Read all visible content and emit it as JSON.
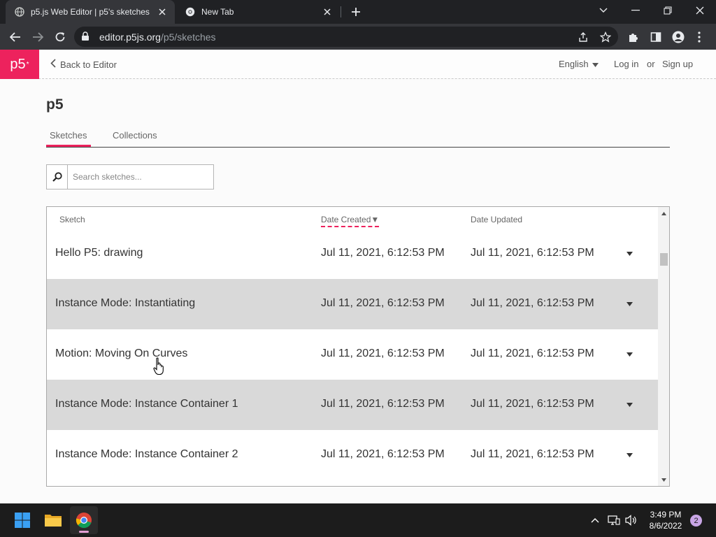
{
  "browser": {
    "tabs": [
      {
        "title": "p5.js Web Editor | p5's sketches",
        "active": true
      },
      {
        "title": "New Tab",
        "active": false
      }
    ],
    "url_host": "editor.p5js.org",
    "url_path": "/p5/sketches"
  },
  "header": {
    "logo": "p5",
    "logo_mark": "*",
    "back_label": "Back to Editor",
    "language": "English",
    "login_label": "Log in",
    "or_label": "or",
    "signup_label": "Sign up"
  },
  "page": {
    "title": "p5",
    "tabs": [
      "Sketches",
      "Collections"
    ],
    "selected_tab": "Sketches"
  },
  "search": {
    "placeholder": "Search sketches..."
  },
  "table": {
    "columns": [
      "Sketch",
      "Date Created",
      "Date Updated"
    ],
    "sort_indicator": "▼",
    "sorted_by": "Date Created",
    "rows": [
      {
        "name": "Hello P5: drawing",
        "created": "Jul 11, 2021, 6:12:53 PM",
        "updated": "Jul 11, 2021, 6:12:53 PM"
      },
      {
        "name": "Instance Mode: Instantiating",
        "created": "Jul 11, 2021, 6:12:53 PM",
        "updated": "Jul 11, 2021, 6:12:53 PM"
      },
      {
        "name": "Motion: Moving On Curves",
        "created": "Jul 11, 2021, 6:12:53 PM",
        "updated": "Jul 11, 2021, 6:12:53 PM"
      },
      {
        "name": "Instance Mode: Instance Container 1",
        "created": "Jul 11, 2021, 6:12:53 PM",
        "updated": "Jul 11, 2021, 6:12:53 PM"
      },
      {
        "name": "Instance Mode: Instance Container 2",
        "created": "Jul 11, 2021, 6:12:53 PM",
        "updated": "Jul 11, 2021, 6:12:53 PM"
      }
    ]
  },
  "taskbar": {
    "time": "3:49 PM",
    "date": "8/6/2022",
    "notification_count": "2",
    "apps": [
      "windows-start-icon",
      "file-explorer-icon",
      "chrome-icon"
    ]
  },
  "colors": {
    "accent": "#ed225d",
    "row_shaded": "#d9d9d9",
    "chrome_dark": "#202124",
    "chrome_toolbar": "#35363a"
  }
}
